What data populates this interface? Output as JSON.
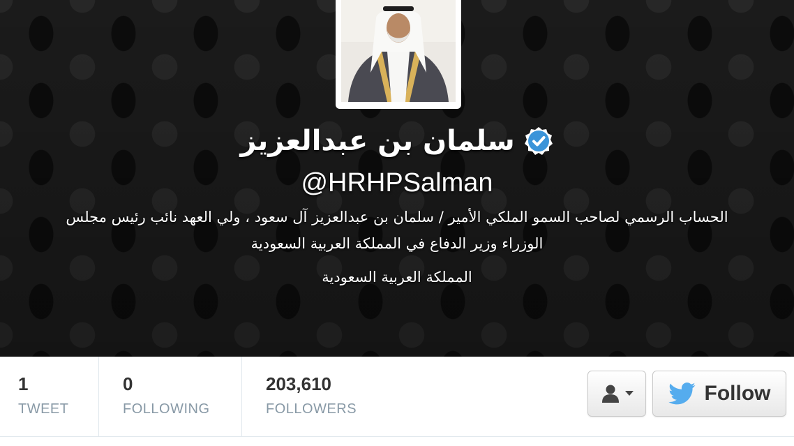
{
  "profile": {
    "display_name": "سلمان بن عبدالعزيز",
    "handle": "@HRHPSalman",
    "bio": "الحساب الرسمي لصاحب السمو الملكي الأمير / سلمان بن عبدالعزيز آل سعود ، ولي العهد نائب رئيس مجلس الوزراء وزير الدفاع في المملكة العربية السعودية",
    "location": "المملكة العربية السعودية",
    "verified_icon": "verified-badge-icon"
  },
  "stats": {
    "tweets": {
      "value": "1",
      "label": "TWEET"
    },
    "following": {
      "value": "0",
      "label": "FOLLOWING"
    },
    "followers": {
      "value": "203,610",
      "label": "FOLLOWERS"
    }
  },
  "actions": {
    "user_menu_icon": "user-dropdown-icon",
    "follow_label": "Follow",
    "follow_icon": "twitter-bird-icon"
  },
  "colors": {
    "header_bg": "#1b1b1b",
    "verified_blue": "#3b94d9",
    "twitter_blue": "#55acee",
    "stat_label": "#8899a6",
    "stat_value": "#333333"
  }
}
